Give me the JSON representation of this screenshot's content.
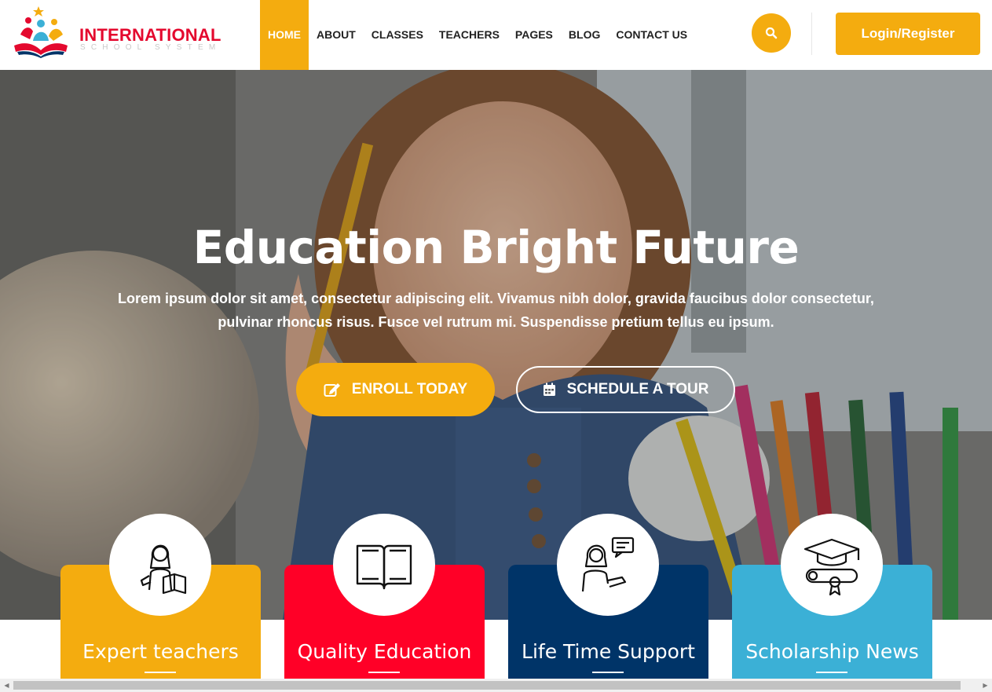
{
  "brand": {
    "title": "INTERNATIONAL",
    "subtitle": "SCHOOL SYSTEM"
  },
  "nav": [
    {
      "label": "HOME",
      "active": true
    },
    {
      "label": "ABOUT"
    },
    {
      "label": "CLASSES"
    },
    {
      "label": "TEACHERS"
    },
    {
      "label": "PAGES"
    },
    {
      "label": "BLOG"
    },
    {
      "label": "CONTACT US"
    }
  ],
  "header": {
    "search_icon": "search-icon",
    "login_label": "Login/Register"
  },
  "hero": {
    "title": "Education Bright Future",
    "text": "Lorem ipsum dolor sit amet, consectetur adipiscing elit. Vivamus nibh dolor, gravida faucibus dolor consectetur, pulvinar rhoncus risus. Fusce vel rutrum mi. Suspendisse pretium tellus eu ipsum.",
    "enroll_label": "ENROLL TODAY",
    "enroll_icon": "edit-icon",
    "tour_label": "SCHEDULE A TOUR",
    "tour_icon": "calendar-icon"
  },
  "features": [
    {
      "title": "Expert teachers",
      "icon": "teacher-icon",
      "color": "#f4ac0f"
    },
    {
      "title": "Quality Education",
      "icon": "book-icon",
      "color": "#ff0027"
    },
    {
      "title": "Life Time Support",
      "icon": "support-icon",
      "color": "#003468"
    },
    {
      "title": "Scholarship News",
      "icon": "graduation-cap-icon",
      "color": "#3bb0d6"
    }
  ],
  "colors": {
    "accent": "#f4ac0f",
    "brand_red": "#e4092e"
  }
}
